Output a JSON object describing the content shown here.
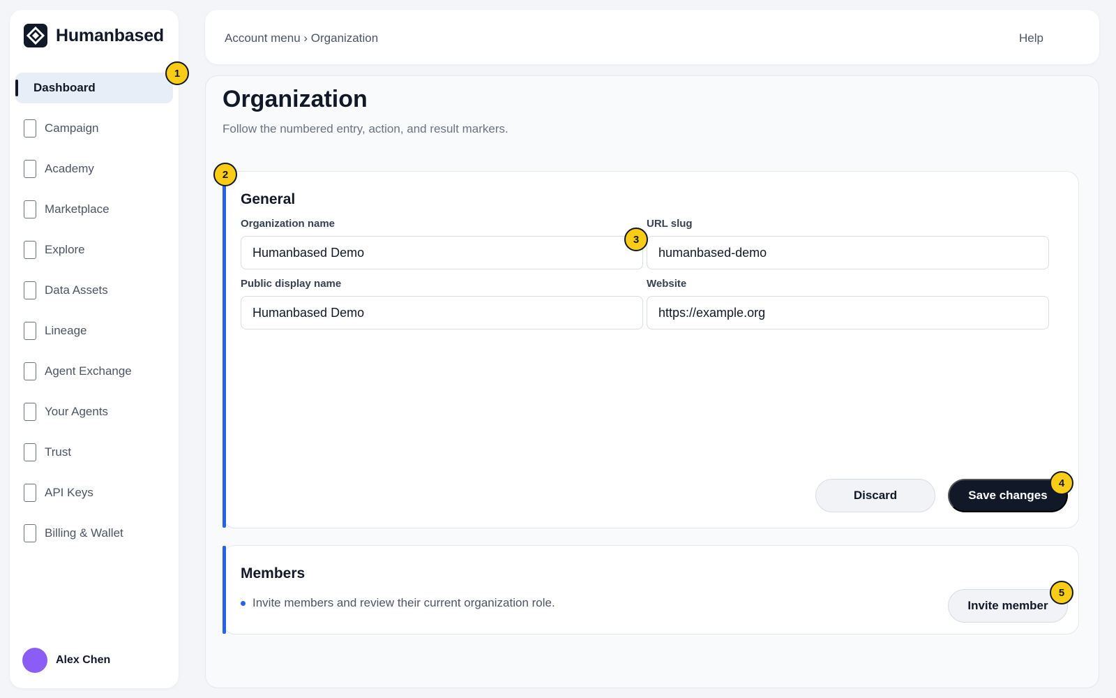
{
  "app": {
    "brand_name": "Humanbased",
    "logo_icon": "diamond-logo-icon"
  },
  "sidebar": {
    "items": [
      {
        "label": "Dashboard",
        "active": true
      },
      {
        "label": "Campaign"
      },
      {
        "label": "Academy"
      },
      {
        "label": "Marketplace"
      },
      {
        "label": "Explore"
      },
      {
        "label": "Data Assets"
      },
      {
        "label": "Lineage"
      },
      {
        "label": "Agent Exchange"
      },
      {
        "label": "Your Agents"
      },
      {
        "label": "Trust"
      },
      {
        "label": "API Keys"
      },
      {
        "label": "Billing & Wallet"
      }
    ],
    "user": {
      "name": "Alex Chen",
      "avatar_color": "#8b5cf6"
    }
  },
  "header": {
    "breadcrumb": "Account menu › Organization",
    "help_label": "Help"
  },
  "page": {
    "title": "Organization",
    "subtitle": "Follow the numbered entry, action, and result markers."
  },
  "general": {
    "title": "General",
    "fields": {
      "org_name": {
        "label": "Organization name",
        "value": "Humanbased Demo"
      },
      "url_slug": {
        "label": "URL slug",
        "value": "humanbased-demo"
      },
      "display_name": {
        "label": "Public display name",
        "value": "Humanbased Demo"
      },
      "website": {
        "label": "Website",
        "value": "https://example.org"
      }
    },
    "discard_label": "Discard",
    "save_label": "Save changes"
  },
  "members": {
    "title": "Members",
    "description": "Invite members and review their current organization role.",
    "invite_label": "Invite member"
  },
  "markers": [
    "1",
    "2",
    "3",
    "4",
    "5"
  ],
  "colors": {
    "accent": "#2563eb",
    "marker": "#facc15",
    "primary_button": "#111827",
    "active_nav_bg": "#e8eef8"
  }
}
